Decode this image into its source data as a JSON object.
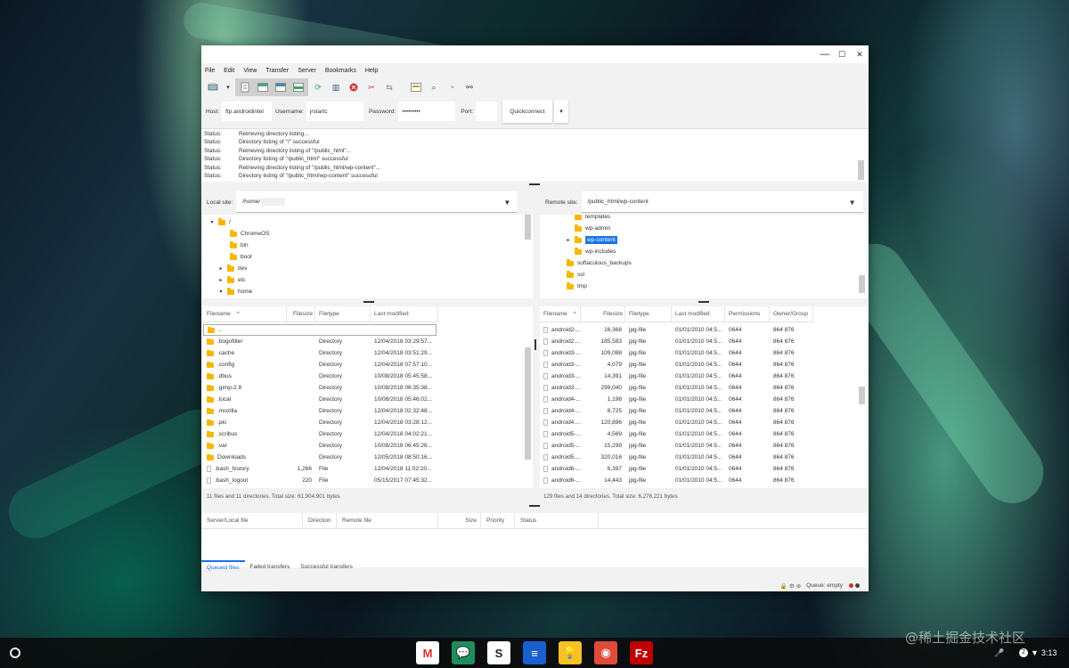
{
  "menu": [
    "File",
    "Edit",
    "View",
    "Transfer",
    "Server",
    "Bookmarks",
    "Help"
  ],
  "toolbar_icons": [
    "site-manager-icon",
    "dropdown-arrow-icon",
    "toggle-log-icon",
    "toggle-local-tree-icon",
    "toggle-remote-tree-icon",
    "toggle-queue-icon",
    "refresh-icon",
    "process-queue-icon",
    "cancel-icon",
    "disconnect-icon",
    "reconnect-icon",
    "filter-icon",
    "sync-browse-icon",
    "compare-icon",
    "search-icon"
  ],
  "window_controls": {
    "minimize": "—",
    "maximize": "☐",
    "close": "✕"
  },
  "quickconnect": {
    "host_label": "Host:",
    "host_value": "ftp.androidintel",
    "username_label": "Username:",
    "username_value": "jrstartc",
    "password_label": "Password:",
    "password_value": "•••••••••",
    "port_label": "Port:",
    "port_value": "",
    "button": "Quickconnect",
    "dropdown": "▾"
  },
  "log": [
    {
      "status": "Status:",
      "text": "Retrieving directory listing..."
    },
    {
      "status": "Status:",
      "text": "Directory listing of \"/\" successful"
    },
    {
      "status": "Status:",
      "text": "Retrieving directory listing of \"/public_html\"..."
    },
    {
      "status": "Status:",
      "text": "Directory listing of \"/public_html\" successful"
    },
    {
      "status": "Status:",
      "text": "Retrieving directory listing of \"/public_html/wp-content\"..."
    },
    {
      "status": "Status:",
      "text": "Directory listing of \"/public_html/wp-content\" successful"
    }
  ],
  "local": {
    "label": "Local site:",
    "path": "/home/",
    "tree": [
      {
        "name": "/",
        "expander": "▾",
        "depth": 0
      },
      {
        "name": "ChromeOS",
        "expander": "",
        "depth": 1
      },
      {
        "name": "bin",
        "expander": "",
        "depth": 1
      },
      {
        "name": "boot",
        "expander": "",
        "depth": 1
      },
      {
        "name": "dev",
        "expander": "▸",
        "depth": 1
      },
      {
        "name": "etc",
        "expander": "▸",
        "depth": 1
      },
      {
        "name": "home",
        "expander": "▾",
        "depth": 1
      }
    ],
    "columns": [
      "Filename",
      "Filesize",
      "Filetype",
      "Last modified"
    ],
    "sort_indicator": "^",
    "files": [
      {
        "name": "..",
        "size": "",
        "type": "",
        "modified": "",
        "kind": "folder"
      },
      {
        "name": ".bogofilter",
        "size": "",
        "type": "Directory",
        "modified": "12/04/2018 03:29:57...",
        "kind": "folder"
      },
      {
        "name": ".cache",
        "size": "",
        "type": "Directory",
        "modified": "12/04/2018 03:51:29...",
        "kind": "folder"
      },
      {
        "name": ".config",
        "size": "",
        "type": "Directory",
        "modified": "12/04/2018 07:57:10...",
        "kind": "folder"
      },
      {
        "name": ".dbus",
        "size": "",
        "type": "Directory",
        "modified": "10/08/2018 05:45:58...",
        "kind": "folder"
      },
      {
        "name": ".gimp-2.8",
        "size": "",
        "type": "Directory",
        "modified": "10/08/2018 06:35:38...",
        "kind": "folder"
      },
      {
        "name": ".local",
        "size": "",
        "type": "Directory",
        "modified": "10/08/2018 05:46:02...",
        "kind": "folder"
      },
      {
        "name": ".mozilla",
        "size": "",
        "type": "Directory",
        "modified": "12/04/2018 02:32:48...",
        "kind": "folder"
      },
      {
        "name": ".pki",
        "size": "",
        "type": "Directory",
        "modified": "12/04/2018 03:28:12...",
        "kind": "folder"
      },
      {
        "name": ".scribus",
        "size": "",
        "type": "Directory",
        "modified": "12/04/2018 04:02:21...",
        "kind": "folder"
      },
      {
        "name": ".var",
        "size": "",
        "type": "Directory",
        "modified": "10/08/2018 06:45:26...",
        "kind": "folder"
      },
      {
        "name": "Downloads",
        "size": "",
        "type": "Directory",
        "modified": "12/05/2018 08:50:16...",
        "kind": "folder"
      },
      {
        "name": ".bash_history",
        "size": "1,266",
        "type": "File",
        "modified": "12/04/2018 11:02:20...",
        "kind": "file"
      },
      {
        "name": ".bash_logout",
        "size": "220",
        "type": "File",
        "modified": "05/15/2017 07:45:32...",
        "kind": "file"
      }
    ],
    "summary": "11 files and 11 directories. Total size: 61,904,901 bytes"
  },
  "remote": {
    "label": "Remote site:",
    "path": "/public_html/wp-content",
    "tree": [
      {
        "name": "templates",
        "expander": "",
        "depth": 2,
        "selected": false
      },
      {
        "name": "wp-admin",
        "expander": "",
        "depth": 2,
        "selected": false
      },
      {
        "name": "wp-content",
        "expander": "▸",
        "depth": 2,
        "selected": true
      },
      {
        "name": "wp-includes",
        "expander": "",
        "depth": 2,
        "selected": false
      },
      {
        "name": "softaculous_backups",
        "expander": "",
        "depth": 1,
        "selected": false
      },
      {
        "name": "ssl",
        "expander": "",
        "depth": 1,
        "selected": false
      },
      {
        "name": "tmp",
        "expander": "",
        "depth": 1,
        "selected": false
      }
    ],
    "columns": [
      "Filename",
      "Filesize",
      "Filetype",
      "Last modified",
      "Permissions",
      "Owner/Group"
    ],
    "sort_indicator": "^",
    "files": [
      {
        "name": "android2-...",
        "size": "16,368",
        "type": "jpg-file",
        "modified": "01/01/2010 04:5...",
        "perm": "0644",
        "owner": "864 876"
      },
      {
        "name": "android2....",
        "size": "185,583",
        "type": "jpg-file",
        "modified": "01/01/2010 04:5...",
        "perm": "0644",
        "owner": "864 876"
      },
      {
        "name": "android3-...",
        "size": "109,088",
        "type": "jpg-file",
        "modified": "01/01/2010 04:5...",
        "perm": "0644",
        "owner": "864 876"
      },
      {
        "name": "android3-...",
        "size": "4,079",
        "type": "jpg-file",
        "modified": "01/01/2010 04:5...",
        "perm": "0644",
        "owner": "864 876"
      },
      {
        "name": "android3-...",
        "size": "14,391",
        "type": "jpg-file",
        "modified": "01/01/2010 04:5...",
        "perm": "0644",
        "owner": "864 876"
      },
      {
        "name": "android3....",
        "size": "299,040",
        "type": "jpg-file",
        "modified": "01/01/2010 04:5...",
        "perm": "0644",
        "owner": "864 876"
      },
      {
        "name": "android4-...",
        "size": "1,198",
        "type": "jpg-file",
        "modified": "01/01/2010 04:5...",
        "perm": "0644",
        "owner": "864 876"
      },
      {
        "name": "android4-...",
        "size": "8,725",
        "type": "jpg-file",
        "modified": "01/01/2010 04:5...",
        "perm": "0644",
        "owner": "864 876"
      },
      {
        "name": "android4....",
        "size": "120,896",
        "type": "jpg-file",
        "modified": "01/01/2010 04:5...",
        "perm": "0644",
        "owner": "864 876"
      },
      {
        "name": "android5-...",
        "size": "4,569",
        "type": "jpg-file",
        "modified": "01/01/2010 04:5...",
        "perm": "0644",
        "owner": "864 876"
      },
      {
        "name": "android5-...",
        "size": "15,299",
        "type": "jpg-file",
        "modified": "01/01/2010 04:5...",
        "perm": "0644",
        "owner": "864 876"
      },
      {
        "name": "android5....",
        "size": "320,016",
        "type": "jpg-file",
        "modified": "01/01/2010 04:5...",
        "perm": "0644",
        "owner": "864 876"
      },
      {
        "name": "android6-...",
        "size": "6,397",
        "type": "jpg-file",
        "modified": "01/01/2010 04:5...",
        "perm": "0644",
        "owner": "864 876"
      },
      {
        "name": "android6-...",
        "size": "14,443",
        "type": "jpg-file",
        "modified": "01/01/2010 04:5...",
        "perm": "0644",
        "owner": "864 876"
      }
    ],
    "summary": "129 files and 14 directories. Total size: 6,278,221 bytes"
  },
  "queue": {
    "columns": [
      "Server/Local file",
      "Direction",
      "Remote file",
      "Size",
      "Priority",
      "Status"
    ],
    "tabs": [
      "Queued files",
      "Failed transfers",
      "Successful transfers"
    ],
    "active_tab": 0,
    "status_text": "Queue: empty",
    "status_icons": [
      "lock-icon",
      "gear-icon",
      "network-icon"
    ],
    "indicator_colors": [
      "#c0392b",
      "#444444"
    ]
  },
  "shelf": {
    "apps": [
      {
        "name": "gmail-icon",
        "glyph": "M",
        "color": "#ffffff",
        "fg": "#d93025"
      },
      {
        "name": "hangouts-chat-icon",
        "glyph": "💬",
        "color": "#1e8e5e",
        "fg": "#ffffff"
      },
      {
        "name": "slides-icon",
        "glyph": "S",
        "color": "#ffffff",
        "fg": "#222222"
      },
      {
        "name": "docs-icon",
        "glyph": "≡",
        "color": "#1a5fd0",
        "fg": "#ffffff"
      },
      {
        "name": "keep-icon",
        "glyph": "💡",
        "color": "#f6c026",
        "fg": "#ffffff"
      },
      {
        "name": "chrome-icon",
        "glyph": "◉",
        "color": "#e04a3a",
        "fg": "#ffffff"
      },
      {
        "name": "filezilla-icon",
        "glyph": "Fz",
        "color": "#bf0000",
        "fg": "#ffffff"
      }
    ],
    "tray": {
      "notifications": "2",
      "time": "3:13"
    }
  },
  "watermark": "@稀土掘金技术社区"
}
